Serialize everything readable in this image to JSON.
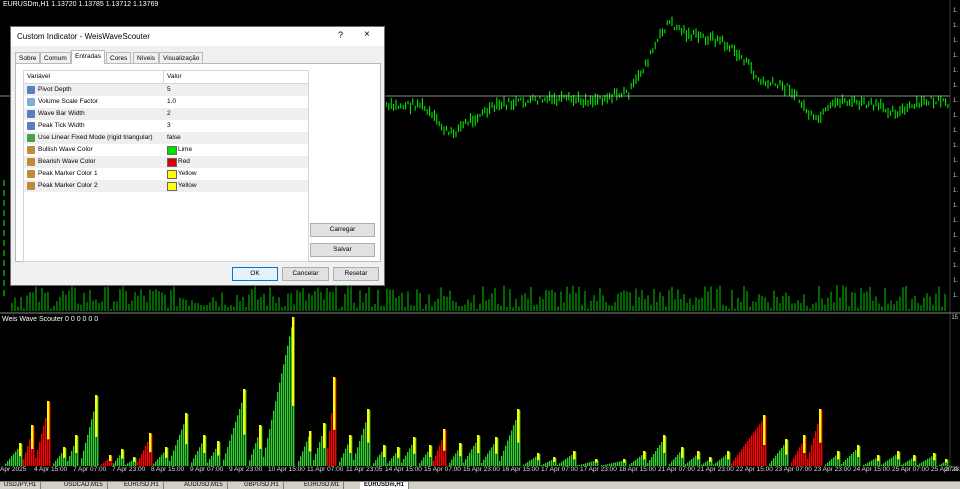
{
  "chart": {
    "symbol_label": "EURUSDm,H1  1.13720  1.13785  1.13712  1.13769",
    "indicator_label": "Weis Wave Scouter 0 0 0 0 0 0",
    "indicator_scale": "15",
    "price_ticks": [
      "1.",
      "1.",
      "1.",
      "1.",
      "1.",
      "1.",
      "1.",
      "1.",
      "1.",
      "1.",
      "1.",
      "1.",
      "1.",
      "1.",
      "1.",
      "1.",
      "1.",
      "1.",
      "1.",
      "1."
    ],
    "time_ticks": [
      "Apr 2025",
      "4 Apr 15:00",
      "7 Apr 07:00",
      "7 Apr 23:00",
      "8 Apr 15:00",
      "9 Apr 07:00",
      "9 Apr 23:00",
      "10 Apr 15:00",
      "11 Apr 07:00",
      "11 Apr 23:05",
      "14 Apr 15:00",
      "15 Apr 07:00",
      "15 Apr 23:00",
      "16 Apr 15:00",
      "17 Apr 07:00",
      "17 Apr 23:00",
      "18 Apr 15:00",
      "21 Apr 07:00",
      "21 Apr 23:00",
      "22 Apr 15:00",
      "23 Apr 07:00",
      "23 Apr 23:00",
      "24 Apr 15:00",
      "25 Apr 07:00",
      "25 Apr 23:00",
      "27 A"
    ],
    "colors": {
      "background": "#000000",
      "candle": "#00ff00",
      "bull": "#32cd32",
      "bear": "#ff0000",
      "peak": "#ffff00"
    },
    "bottom_tabs": [
      "USDJPY,H1",
      "USDCAD,M15",
      "EURUSD,H1",
      "AUDUSD,M15",
      "GBPUSD,H1",
      "EURUSD,M1",
      "EURUSDm,H1"
    ]
  },
  "dialog": {
    "title": "Custom Indicator - WeisWaveScouter",
    "help_label": "?",
    "close_label": "×",
    "tabs": [
      "Sobre",
      "Comum",
      "Entradas",
      "Cores",
      "Níveis",
      "Visualização"
    ],
    "active_tab": "Entradas",
    "columns": {
      "variable": "Variável",
      "value": "Valor"
    },
    "rows": [
      {
        "name": "Pivot Depth",
        "value": "5",
        "icon": "number-icon"
      },
      {
        "name": "Volume Scale Factor",
        "value": "1.0",
        "icon": "decimal-icon"
      },
      {
        "name": "Wave Bar Width",
        "value": "2",
        "icon": "number-icon"
      },
      {
        "name": "Peak Tick Width",
        "value": "3",
        "icon": "number-icon"
      },
      {
        "name": "Use Linear Fixed Mode (rigid triangular)",
        "value": "false",
        "icon": "bool-icon"
      },
      {
        "name": "Bullish Wave Color",
        "value": "Lime",
        "icon": "color-icon",
        "swatch": "#00e000"
      },
      {
        "name": "Bearish Wave Color",
        "value": "Red",
        "icon": "color-icon",
        "swatch": "#e00000"
      },
      {
        "name": "Peak Marker Color 1",
        "value": "Yellow",
        "icon": "color-icon",
        "swatch": "#ffff00"
      },
      {
        "name": "Peak Marker Color 2",
        "value": "Yellow",
        "icon": "color-icon",
        "swatch": "#ffff00"
      }
    ],
    "buttons": {
      "load": "Carregar",
      "save": "Salvar",
      "ok": "OK",
      "cancel": "Cancelar",
      "reset": "Resetar"
    }
  }
}
